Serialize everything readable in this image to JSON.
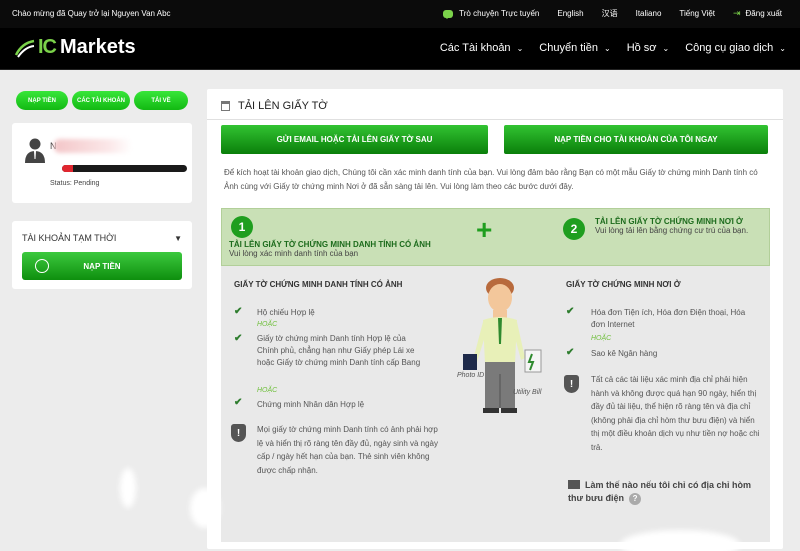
{
  "topbar": {
    "welcome": "Chào mừng đã Quay trở lại Nguyen Van Abc",
    "chat": "Trò chuyện Trực tuyến",
    "languages": [
      "English",
      "汉语",
      "Italiano",
      "Tiếng Việt"
    ],
    "logout": "Đăng xuất"
  },
  "header": {
    "logo_ic": "IC",
    "logo_text": "Markets",
    "nav": [
      "Các Tài khoản",
      "Chuyển tiền",
      "Hồ sơ",
      "Công cụ giao dịch"
    ]
  },
  "sidebar": {
    "quick_buttons": [
      "NẠP TIỀN",
      "CÁC TÀI KHOẢN",
      "TẢI VỀ"
    ],
    "profile": {
      "initial": "N",
      "status": "Status: Pending",
      "progress": 0.09
    },
    "account": {
      "title": "TÀI KHOẢN TẠM THỜI",
      "deposit": "NẠP TIỀN"
    }
  },
  "main": {
    "title": "TẢI LÊN GIẤY TỜ",
    "btn_email": "GỬI EMAIL HOẶC TẢI LÊN GIẤY TỜ SAU",
    "btn_deposit": "NẠP TIỀN CHO TÀI KHOẢN CỦA TÔI NGAY",
    "intro": "Để kích hoạt tài khoản giao dịch, Chúng tôi cần xác minh danh tính của bạn. Vui lòng đảm bảo rằng Bạn có một mẫu Giấy tờ chứng minh Danh tính có Ảnh cùng với Giấy tờ chứng minh Nơi ở đã sẵn sàng tải lên. Vui lòng làm theo các bước dưới đây.",
    "step1": {
      "num": "1",
      "title": "TẢI LÊN GIẤY TỜ CHỨNG MINH DANH TÍNH CÓ ẢNH",
      "sub": "Vui lòng xác minh danh tính của bạn"
    },
    "plus": "+",
    "step2": {
      "num": "2",
      "title": "TẢI LÊN GIẤY TỜ CHỨNG MINH NƠI Ở",
      "sub": "Vui lòng tải lên bằng chứng cư trú của bạn."
    },
    "left": {
      "title": "GIẤY TỜ CHỨNG MINH DANH TÍNH CÓ ẢNH",
      "item1": "Hộ chiếu Hợp lệ",
      "or1": "HOẶC",
      "item2": "Giấy tờ chứng minh Danh tính Hợp lệ của Chính phủ, chẳng hạn như Giấy phép Lái xe hoặc Giấy tờ chứng minh Danh tính cấp Bang",
      "or2": "HOẶC",
      "item3": "Chứng minh Nhân dân Hợp lệ",
      "note": "Mọi giấy tờ chứng minh Danh tính có ảnh phải hợp lệ và hiển thị rõ ràng tên đầy đủ, ngày sinh và ngày cấp / ngày hết hạn của bạn. Thẻ sinh viên không được chấp nhận."
    },
    "illustration": {
      "photo_id": "Photo ID",
      "utility_bill": "Utility Bill"
    },
    "right": {
      "title": "GIẤY TỜ CHỨNG MINH NƠI Ở",
      "item1": "Hóa đơn Tiện ích, Hóa đơn Điện thoại, Hóa đơn Internet",
      "or1": "HOẶC",
      "item2": "Sao kê Ngân hàng",
      "note": "Tất cả các tài liệu xác minh địa chỉ phải hiện hành và không được quá hạn 90 ngày, hiển thị đầy đủ tài liệu, thể hiện rõ ràng tên và địa chỉ (không phải địa chỉ hòm thư bưu điện) và hiển thị một điều khoản dịch vụ như tiền nợ hoặc chi trả.",
      "question": "Làm thế nào nếu tôi chỉ có địa chỉ hòm thư bưu điện",
      "help": "?"
    }
  },
  "colors": {
    "accent": "#1f9e1f",
    "bright_green": "#2fd62f",
    "topbar": "#0b0b0b"
  },
  "icons": [
    "chat-icon",
    "logout-icon",
    "logo-icon",
    "avatar-icon",
    "dropdown-icon",
    "coin-icon",
    "document-icon",
    "check-icon",
    "shield-icon",
    "mail-icon",
    "help-icon"
  ]
}
